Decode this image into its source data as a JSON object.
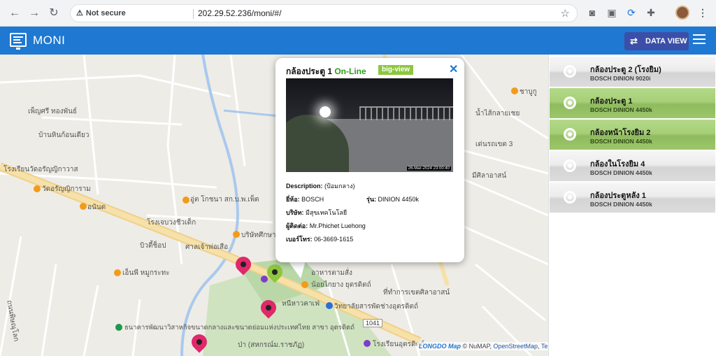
{
  "browser": {
    "security_label": "Not secure",
    "url": "202.29.52.236/moni/#/"
  },
  "app": {
    "title": "MONI",
    "data_view_label": "DATA VIEW"
  },
  "map": {
    "labels": [
      "เพ็ญศรี ทองพันธ์",
      "บ้านหินก้อนเดียว",
      "โรงเรียนวัดอรัญญิกาวาส",
      "วัดอรัญญิการาม",
      "อนันต",
      "อู่ต โกชนา สก.บ.พ.เพ็ต",
      "โรงเจบวงชีวเด็ก",
      "บิวตี้ช็อป",
      "ศาลเจ้าพ่อเสือ",
      "บริษัทศึกษา",
      "เอ็นพี หมูกระทะ",
      "อาหารตามสั่ง",
      "น้อยไกยาง ยุตรดิตถ์",
      "ที่ทำการเขตศิลาอาสน์",
      "หนีหาวคาเฟ่",
      "วิทยาลัยสารพัดช่างอุตรดิตถ์",
      "ธนาคารพัฒนาวิสาหกิจขนาดกลางและขนาดย่อมแห่งประเทศไทย สาขา อุตรดิตถ์",
      "ป่า (สหกรณ์ม.ราชภัฏ)",
      "โรงเรียนอุตรดิตถ์",
      "ชาบูกู",
      "น้ำไส้กลายเชย",
      "เด่นรถเขต 3",
      "มีศิลาอาสน์",
      "ถนนพิษณุโลก"
    ],
    "road_number": "1041",
    "attribution": {
      "brand": "LONGDO Map",
      "copy": "© NuMAP,",
      "osm": "OpenStreetMap",
      "terms": "Terms"
    }
  },
  "popup": {
    "camera_name": "กล้องประตู 1",
    "status": "On-Line",
    "big_view_label": "big-view",
    "feed_timestamp": "26-Mar-2024 23:00:40",
    "description_label": "Description:",
    "description_value": "(ป้อมกลาง)",
    "brand_label": "ยี่ห้อ:",
    "brand_value": "BOSCH",
    "model_label": "รุ่น:",
    "model_value": "DINION 4450k",
    "company_label": "บริษัท:",
    "company_value": "มีสุขเทคโนโลยี",
    "contact_label": "ผู้ติดต่อ:",
    "contact_value": "Mr.Phichet Luehong",
    "phone_label": "เบอร์โทร:",
    "phone_value": "06-3669-1615"
  },
  "cameras": [
    {
      "name": "กล้องประตู 2 (โรงยิม)",
      "model": "BOSCH DINION 9020i",
      "state": "offline"
    },
    {
      "name": "กล้องประตู 1",
      "model": "BOSCH DINION 4450k",
      "state": "online"
    },
    {
      "name": "กล้องหน้าโรงยิม 2",
      "model": "BOSCH DINION 4450k",
      "state": "online"
    },
    {
      "name": "กล้องในโรงยิม 4",
      "model": "BOSCH DINION 4450k",
      "state": "offline"
    },
    {
      "name": "กล้องประตูหลัง 1",
      "model": "BOSCH DINION 4450k",
      "state": "offline"
    }
  ],
  "colors": {
    "app_bar": "#1f78d1",
    "online": "#2e9e19",
    "pin_offline": "#e0286a",
    "pin_online": "#8dc63f"
  }
}
